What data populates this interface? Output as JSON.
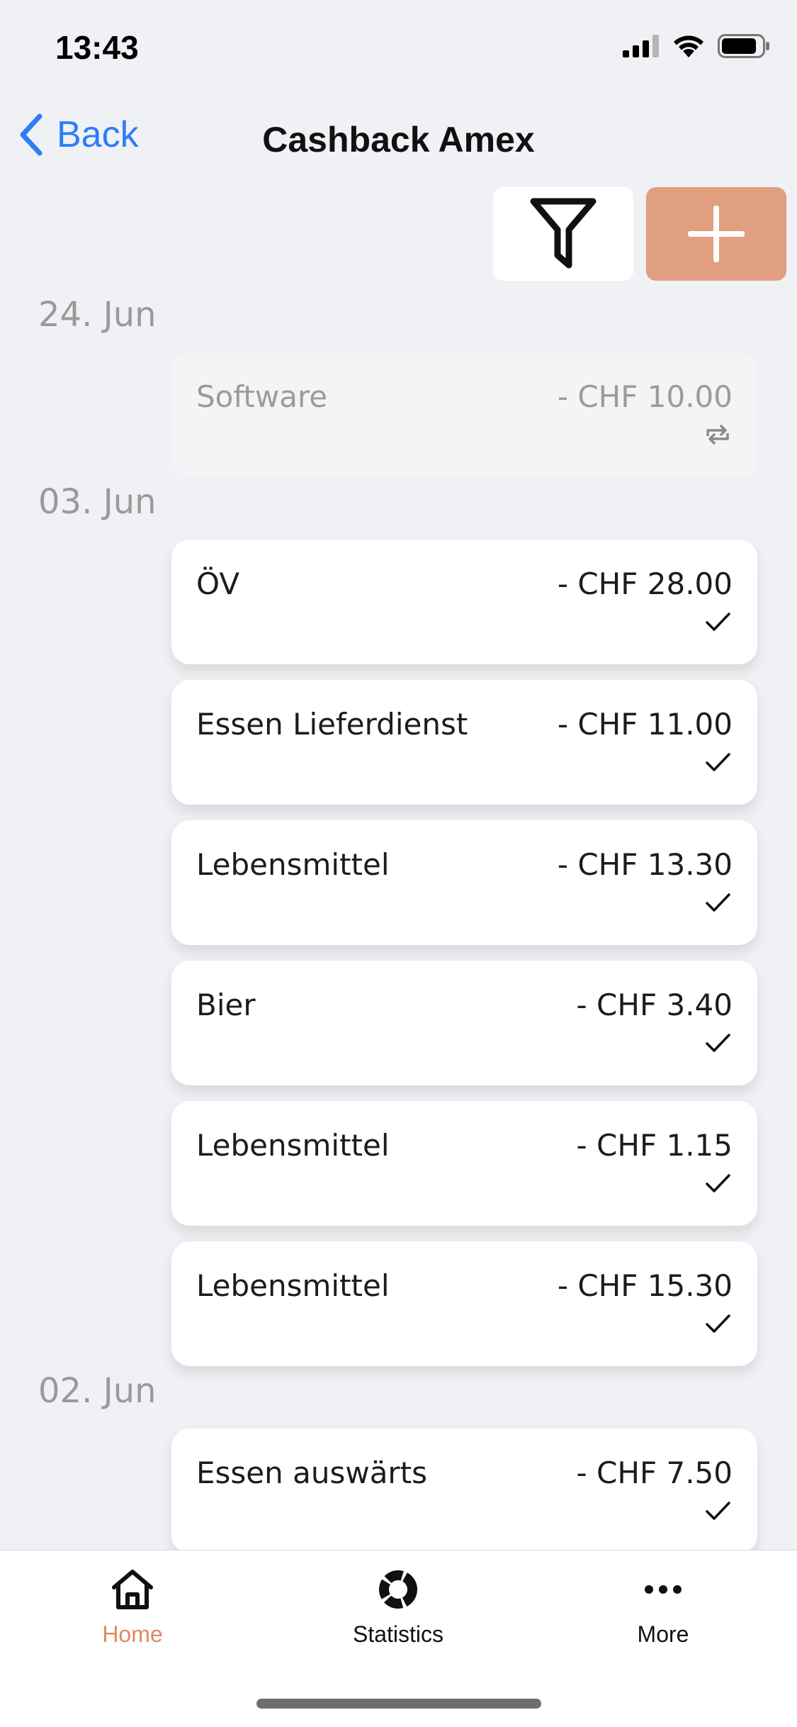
{
  "status_bar": {
    "time": "13:43"
  },
  "nav": {
    "back_label": "Back",
    "title": "Cashback Amex"
  },
  "toolbar": {
    "filter_icon": "funnel-icon",
    "add_icon": "plus-icon",
    "add_color": "#e09f7e"
  },
  "groups": [
    {
      "date": "24. Jun",
      "transactions": [
        {
          "category": "Software",
          "amount": "- CHF 10.00",
          "status": "recurring"
        }
      ]
    },
    {
      "date": "03. Jun",
      "transactions": [
        {
          "category": "ÖV",
          "amount": "- CHF 28.00",
          "status": "checked"
        },
        {
          "category": "Essen Lieferdienst",
          "amount": "- CHF 11.00",
          "status": "checked"
        },
        {
          "category": "Lebensmittel",
          "amount": "- CHF 13.30",
          "status": "checked"
        },
        {
          "category": "Bier",
          "amount": "- CHF 3.40",
          "status": "checked"
        },
        {
          "category": "Lebensmittel",
          "amount": "- CHF 1.15",
          "status": "checked"
        },
        {
          "category": "Lebensmittel",
          "amount": "- CHF 15.30",
          "status": "checked"
        }
      ]
    },
    {
      "date": "02. Jun",
      "transactions": [
        {
          "category": "Essen auswärts",
          "amount": "- CHF 7.50",
          "status": "checked"
        }
      ]
    }
  ],
  "tabbar": {
    "tabs": [
      {
        "label": "Home",
        "icon": "home-icon",
        "active": true
      },
      {
        "label": "Statistics",
        "icon": "statistics-icon",
        "active": false
      },
      {
        "label": "More",
        "icon": "more-icon",
        "active": false
      }
    ],
    "active_color": "#df8a5e"
  }
}
